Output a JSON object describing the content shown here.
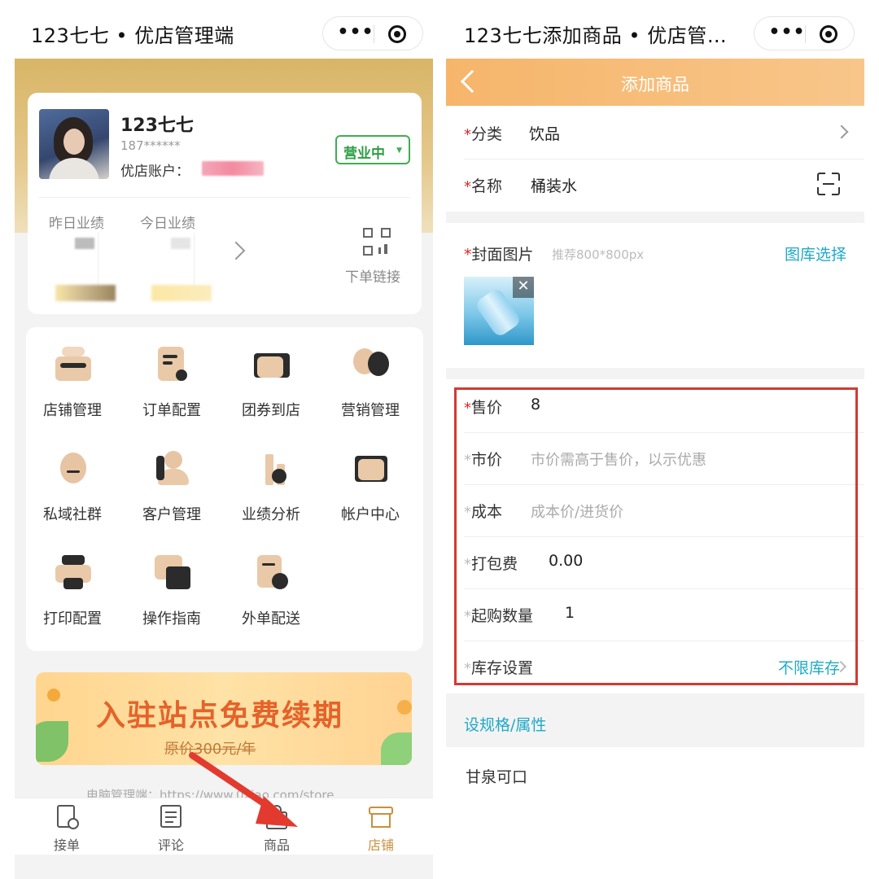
{
  "left": {
    "window_title": "123七七 • 优店管理端",
    "shop_name": "123七七",
    "phone": "187******",
    "account_label": "优店账户：",
    "status": "营业中",
    "yesterday_label": "昨日业绩",
    "today_label": "今日业绩",
    "order_link_label": "下单链接",
    "menu": [
      {
        "label": "店铺管理",
        "icon": "store-box-icon"
      },
      {
        "label": "订单配置",
        "icon": "order-settings-icon"
      },
      {
        "label": "团券到店",
        "icon": "coupon-icon"
      },
      {
        "label": "营销管理",
        "icon": "balloon-icon"
      },
      {
        "label": "私域社群",
        "icon": "community-icon"
      },
      {
        "label": "客户管理",
        "icon": "customer-icon"
      },
      {
        "label": "业绩分析",
        "icon": "analytics-icon"
      },
      {
        "label": "帐户中心",
        "icon": "wallet-icon"
      },
      {
        "label": "打印配置",
        "icon": "printer-icon"
      },
      {
        "label": "操作指南",
        "icon": "guide-chat-icon"
      },
      {
        "label": "外单配送",
        "icon": "delivery-icon"
      }
    ],
    "banner_title": "入驻站点免费续期",
    "banner_sub": "原价300元/年",
    "footer_url": "电脑管理端：https://www.0xiao.com/store",
    "tabs": [
      {
        "label": "接单",
        "icon": "order-receive-icon"
      },
      {
        "label": "评论",
        "icon": "comment-icon"
      },
      {
        "label": "商品",
        "icon": "product-bag-icon"
      },
      {
        "label": "店铺",
        "icon": "shop-icon"
      }
    ],
    "active_tab": "店铺"
  },
  "right": {
    "window_title": "123七七添加商品 • 优店管…",
    "page_title": "添加商品",
    "required_mark": "*",
    "category_label": "分类",
    "category_value": "饮品",
    "name_label": "名称",
    "name_value": "桶装水",
    "cover_label": "封面图片",
    "cover_hint": "推荐800*800px",
    "gallery_link": "图库选择",
    "price_label": "售价",
    "price_value": "8",
    "market_price_label": "市价",
    "market_price_placeholder": "市价需高于售价，以示优惠",
    "cost_label": "成本",
    "cost_placeholder": "成本价/进货价",
    "packing_fee_label": "打包费",
    "packing_fee_value": "0.00",
    "min_qty_label": "起购数量",
    "min_qty_value": "1",
    "stock_label": "库存设置",
    "stock_value": "不限库存",
    "spec_link": "设规格/属性",
    "product_name_display": "甘泉可口"
  },
  "colors": {
    "gold": "#d8b566",
    "header_orange": "#f6b56a",
    "link_blue": "#1fa9c7",
    "status_green": "#3fae52",
    "highlight_red": "#d33a33",
    "required_red": "#e02424",
    "banner_orange": "#e4632a"
  }
}
